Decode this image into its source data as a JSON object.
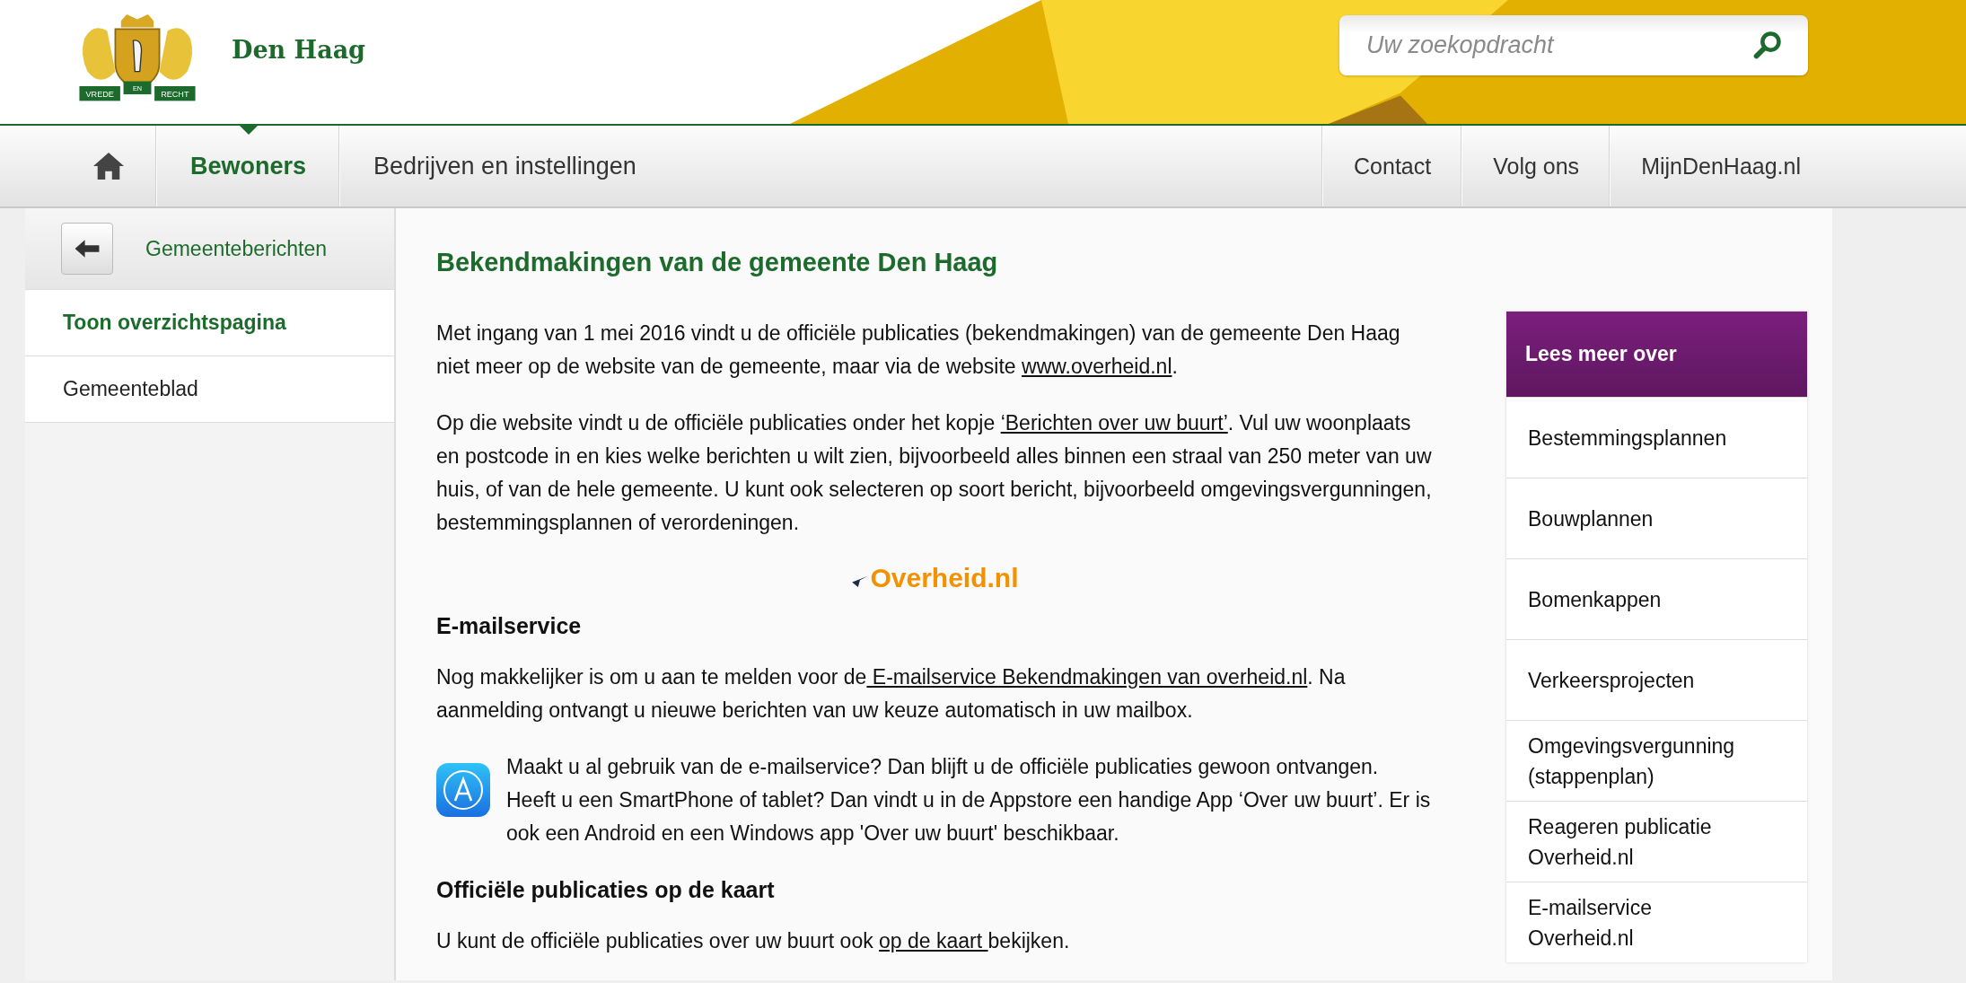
{
  "header": {
    "logo": {
      "motto": [
        "VREDE",
        "EN",
        "RECHT"
      ],
      "name": "Den Haag"
    },
    "search": {
      "placeholder": "Uw zoekopdracht"
    }
  },
  "nav": {
    "main": [
      {
        "label": "Bewoners",
        "selected": true
      },
      {
        "label": "Bedrijven en instellingen",
        "selected": false
      }
    ],
    "secondary": [
      "Contact",
      "Volg ons",
      "MijnDenHaag.nl"
    ]
  },
  "sidebar": {
    "back_label": "Gemeenteberichten",
    "items": [
      {
        "label": "Toon overzichtspagina",
        "selected": true
      },
      {
        "label": "Gemeenteblad",
        "selected": false
      }
    ]
  },
  "article": {
    "title": "Bekendmakingen van de gemeente Den Haag",
    "blocks": [
      {
        "kind": "paragraph",
        "parts": [
          {
            "text": "Met ingang van 1 mei 2016 vindt u de officiële publicaties (bekendmakingen) van de gemeente Den Haag niet meer op de website van de gemeente, maar via de website "
          },
          {
            "text": "www.overheid.nl",
            "link": true
          },
          {
            "text": "."
          }
        ]
      },
      {
        "kind": "paragraph",
        "parts": [
          {
            "text": "Op die website vindt u de officiële publicaties onder het kopje "
          },
          {
            "text": "‘Berichten over uw buurt’",
            "link": true
          },
          {
            "text": ". Vul uw woonplaats en postcode in en kies welke berichten u wilt zien, bijvoorbeeld alles binnen een straal van 250 meter van uw huis, of van de hele gemeente. U kunt ook selecteren op soort bericht, bijvoorbeeld omgevingsvergunningen, bestemmingsplannen of verordeningen."
          }
        ]
      },
      {
        "kind": "logo",
        "text": "Overheid.nl"
      },
      {
        "kind": "heading",
        "text": "E-mailservice"
      },
      {
        "kind": "paragraph",
        "parts": [
          {
            "text": "Nog makkelijker is om u aan te melden voor de"
          },
          {
            "text": " E-mailservice Bekendmakingen van overheid.nl",
            "link": true
          },
          {
            "text": ". Na aanmelding ontvangt u nieuwe berichten van uw keuze automatisch in uw mailbox."
          }
        ]
      },
      {
        "kind": "app_note",
        "text": "Maakt u al gebruik van de e-mailservice? Dan blijft u de officiële publicaties gewoon ontvangen. Heeft u een SmartPhone of tablet? Dan vindt u in de Appstore een handige App ‘Over uw buurt’. Er is ook een Android en een Windows app 'Over uw buurt' beschikbaar."
      },
      {
        "kind": "heading",
        "text": "Officiële publicaties op de kaart"
      },
      {
        "kind": "paragraph",
        "parts": [
          {
            "text": "U kunt de officiële publicaties over uw buurt ook "
          },
          {
            "text": "op de kaart ",
            "link": true
          },
          {
            "text": "bekijken."
          }
        ]
      }
    ]
  },
  "related": {
    "title": "Lees meer over",
    "items": [
      "Bestemmingsplannen",
      "Bouwplannen",
      "Bomenkappen",
      "Verkeersprojecten",
      "Omgevingsvergunning (stappenplan)",
      "Reageren publicatie Overheid.nl",
      "E-mailservice Overheid.nl"
    ]
  }
}
